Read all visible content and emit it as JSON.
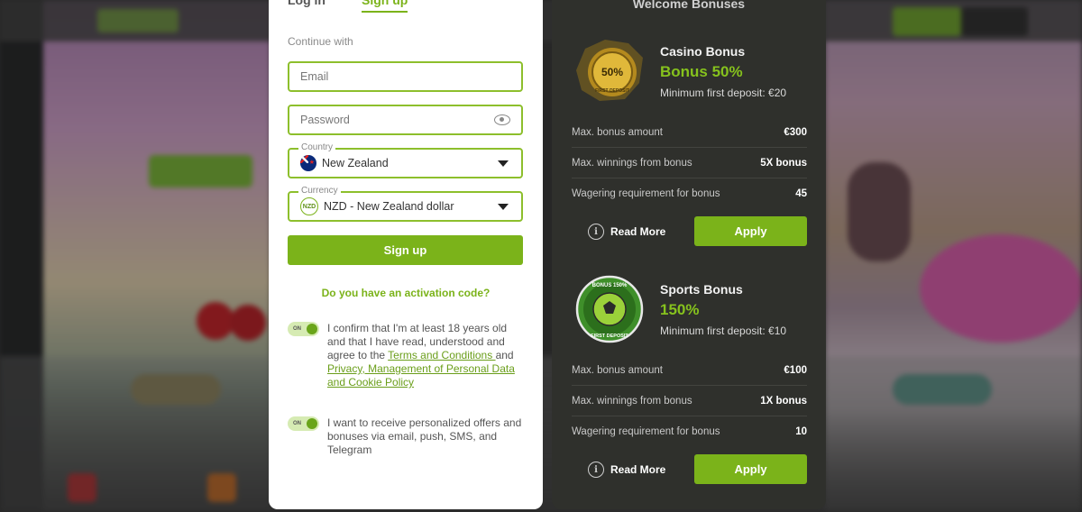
{
  "signup": {
    "tabs": [
      {
        "label": "Log in"
      },
      {
        "label": "Sign up"
      }
    ],
    "continue_with": "Continue with",
    "email_placeholder": "Email",
    "password_placeholder": "Password",
    "country": {
      "label": "Country",
      "value": "New Zealand"
    },
    "currency": {
      "label": "Currency",
      "icon_text": "NZD",
      "value": "NZD - New Zealand dollar"
    },
    "submit_label": "Sign up",
    "activation_question": "Do you have an activation code?",
    "toggle_text": "ON",
    "consent_age": {
      "text_before": "I confirm that I'm at least 18 years old and that I have read, understood and agree to the ",
      "terms_link": "Terms and Conditions ",
      "and_text": "and ",
      "privacy_link": "Privacy, Management of Personal Data and Cookie Policy"
    },
    "consent_offers": "I want to receive personalized offers and bonuses via email, push, SMS, and Telegram"
  },
  "bonuses": {
    "title": "Welcome Bonuses",
    "items": [
      {
        "name": "Casino Bonus",
        "percent": "Bonus 50%",
        "min_deposit": "Minimum first deposit: €20",
        "badge_text": "50%",
        "badge_sub": "FIRST DEPOSIT",
        "rows": [
          {
            "label": "Max. bonus amount",
            "value": "€300"
          },
          {
            "label": "Max. winnings from bonus",
            "value": "5X bonus"
          },
          {
            "label": "Wagering requirement for bonus",
            "value": "45"
          }
        ],
        "read_more": "Read More",
        "apply": "Apply"
      },
      {
        "name": "Sports Bonus",
        "percent": "150%",
        "min_deposit": "Minimum first deposit: €10",
        "badge_text": "BONUS 150%",
        "badge_sub": "FIRST DEPOSIT",
        "rows": [
          {
            "label": "Max. bonus amount",
            "value": "€100"
          },
          {
            "label": "Max. winnings from bonus",
            "value": "1X bonus"
          },
          {
            "label": "Wagering requirement for bonus",
            "value": "10"
          }
        ],
        "read_more": "Read More",
        "apply": "Apply"
      }
    ]
  },
  "colors": {
    "accent": "#7bb31a",
    "bonus_panel": "#2f302c",
    "badge_gold": "#c9a227",
    "badge_green": "#3f8f2a"
  }
}
